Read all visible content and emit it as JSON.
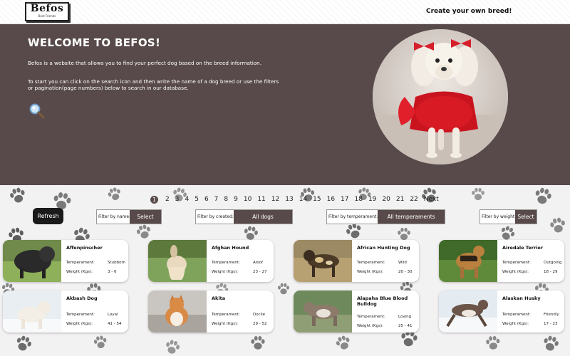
{
  "header": {
    "logo_main": "Befos",
    "logo_sub": "Best Friends",
    "create_link": "Create your own breed!"
  },
  "hero": {
    "title": "WELCOME TO BEFOS!",
    "paragraph1": "Befos is a website that allows you to find your perfect dog based on the breed information.",
    "paragraph2": "To start you can click on the search icon and then write the name of a dog breed or use the filters or pagination(page numbers) below to search in our database."
  },
  "pagination": {
    "current": "1",
    "pages": [
      "2",
      "3",
      "4",
      "5",
      "6",
      "7",
      "8",
      "9",
      "10",
      "11",
      "12",
      "13",
      "14",
      "15",
      "16",
      "17",
      "18",
      "19",
      "20",
      "21",
      "22"
    ],
    "next_label": "Next"
  },
  "filters": {
    "refresh_label": "Refresh",
    "name": {
      "label": "Filter by name:",
      "value": "Select"
    },
    "created": {
      "label": "Filter by created:",
      "value": "All dogs"
    },
    "temperament": {
      "label": "Filter by temperament:",
      "value": "All temperaments"
    },
    "weight": {
      "label": "Filter by weight:",
      "value": "Select"
    }
  },
  "card_labels": {
    "temperament": "Temperament:",
    "weight": "Weight (Kgs):"
  },
  "cards": [
    {
      "name": "Affenpinscher",
      "temperament": "Stubborn",
      "weight": "3 - 6"
    },
    {
      "name": "Afghan Hound",
      "temperament": "Aloof",
      "weight": "23 - 27"
    },
    {
      "name": "African Hunting Dog",
      "temperament": "Wild",
      "weight": "20 - 30"
    },
    {
      "name": "Airedale Terrier",
      "temperament": "Outgoing",
      "weight": "18 - 29"
    },
    {
      "name": "Akbash Dog",
      "temperament": "Loyal",
      "weight": "41 - 54"
    },
    {
      "name": "Akita",
      "temperament": "Docile",
      "weight": "29 - 52"
    },
    {
      "name": "Alapaha Blue Blood Bulldog",
      "temperament": "Loving",
      "weight": "25 - 41"
    },
    {
      "name": "Alaskan Husky",
      "temperament": "Friendly",
      "weight": "17 - 23"
    }
  ],
  "colors": {
    "brand": "#584a4a",
    "button_dark": "#1a1a1a",
    "background": "#f3f2f2"
  }
}
